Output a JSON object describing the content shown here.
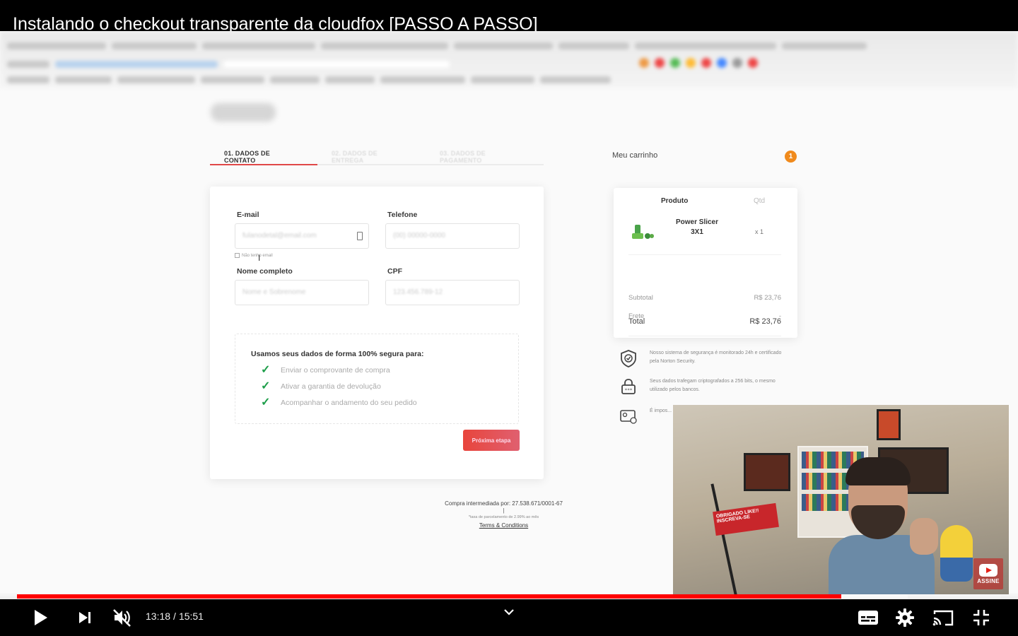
{
  "video": {
    "title": "Instalando o checkout transparente da cloudfox [PASSO A PASSO]",
    "current_time": "13:18",
    "duration": "15:51",
    "time_separator": "/",
    "progress_fraction": 0.838,
    "buffered_fraction": 0.905
  },
  "checkout": {
    "tabs": [
      {
        "label": "01. DADOS DE CONTATO",
        "active": true
      },
      {
        "label": "02. DADOS DE ENTREGA",
        "active": false
      },
      {
        "label": "03. DADOS DE PAGAMENTO",
        "active": false
      }
    ],
    "fields": {
      "email": {
        "label": "E-mail",
        "placeholder": "fulanodetal@email.com"
      },
      "phone": {
        "label": "Telefone",
        "placeholder": "(00) 00000-0000"
      },
      "name": {
        "label": "Nome completo",
        "placeholder": "Nome e Sobrenome"
      },
      "cpf": {
        "label": "CPF",
        "placeholder": "123.456.789-12"
      }
    },
    "no_email_label": "Não tenho email",
    "secure": {
      "title": "Usamos seus dados de forma 100% segura para:",
      "items": [
        "Enviar o comprovante de compra",
        "Ativar a garantia de devolução",
        "Acompanhar o andamento do seu pedido"
      ]
    },
    "next_button": "Próxima etapa",
    "footer": {
      "intermediated": "Compra intermediada por: 27.538.671/0001-67",
      "separator": "|",
      "installments_note": "*taxa de parcelamento de 2.99% ao mês",
      "terms": "Terms & Conditions"
    }
  },
  "cart": {
    "title": "Meu carrinho",
    "badge": "1",
    "head_product": "Produto",
    "head_qty": "Qtd",
    "product_name": "Power Slicer 3X1",
    "product_qty": "x 1",
    "subtotal_label": "Subtotal",
    "subtotal_value": "R$ 23,76",
    "shipping_label": "Frete",
    "shipping_value": "-",
    "total_label": "Total",
    "total_value": "R$ 23,76"
  },
  "trust": [
    {
      "icon": "shield-check-icon",
      "text": "Nosso sistema de segurança é monitorado 24h e certificado pela Norton Security."
    },
    {
      "icon": "lock-icon",
      "text": "Seus dados trafegam criptografados a 256 bits, o mesmo utilizado pelos bancos."
    },
    {
      "icon": "id-card-icon",
      "text": "É impos... nenhum... sistema..."
    }
  ],
  "webcam": {
    "sign_text": "OBRIGADO LIKE!! INSCREVA-SE",
    "subscribe_label": "ASSINE"
  },
  "colors": {
    "progress": "#ff0000",
    "tab_active": "#e04848",
    "cart_badge": "#f08a1c",
    "check": "#1e9e4a",
    "next_button": "#e8453c"
  }
}
